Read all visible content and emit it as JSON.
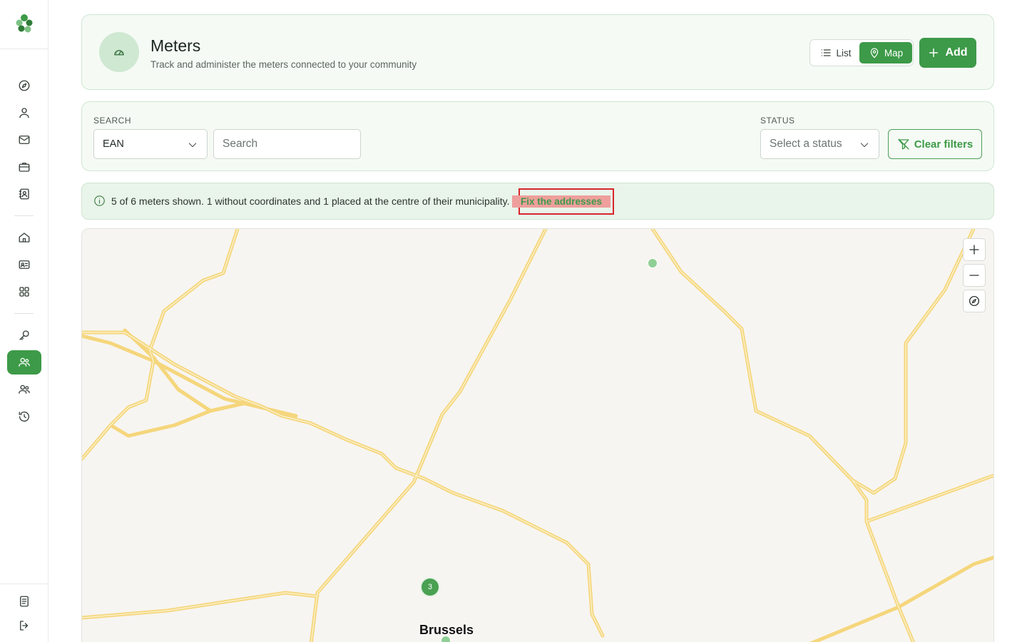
{
  "header": {
    "title": "Meters",
    "subtitle": "Track and administer the meters connected to your community",
    "view_list_label": "List",
    "view_map_label": "Map",
    "add_label": "Add"
  },
  "filters": {
    "search_label": "SEARCH",
    "search_field_selected": "EAN",
    "search_placeholder": "Search",
    "status_label": "STATUS",
    "status_placeholder": "Select a status",
    "clear_label": "Clear filters"
  },
  "info": {
    "message": "5 of 6 meters shown. 1 without coordinates and 1 placed at the centre of their municipality.",
    "fix_link": "Fix the addresses"
  },
  "map": {
    "cluster_count": "3",
    "city_label": "Brussels"
  },
  "colors": {
    "brand": "#3d9a48",
    "card_bg": "#f5faf5",
    "map_bg": "#f7f5f1",
    "road": "#f7dd8e",
    "highlight": "#d9262a"
  }
}
